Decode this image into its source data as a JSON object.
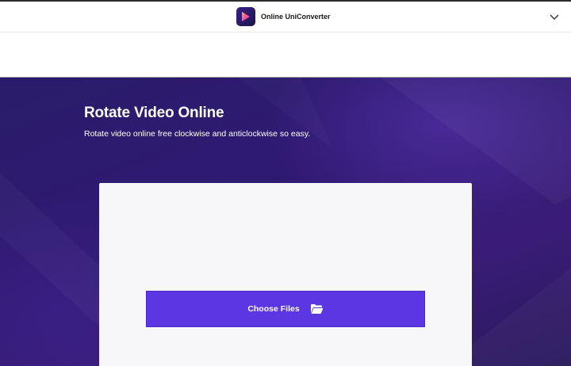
{
  "header": {
    "brand_name": "Online UniConverter",
    "logo_icon": "uniconverter-logo-icon",
    "menu_icon": "chevron-down-icon"
  },
  "hero": {
    "title": "Rotate Video Online",
    "subtitle": "Rotate video online free clockwise and anticlockwise so easy."
  },
  "upload": {
    "button_label": "Choose Files",
    "button_icon": "folder-open-icon"
  },
  "colors": {
    "accent": "#5b36e3",
    "hero_background": "#2f1a72",
    "panel_background": "#f7f7f9"
  }
}
